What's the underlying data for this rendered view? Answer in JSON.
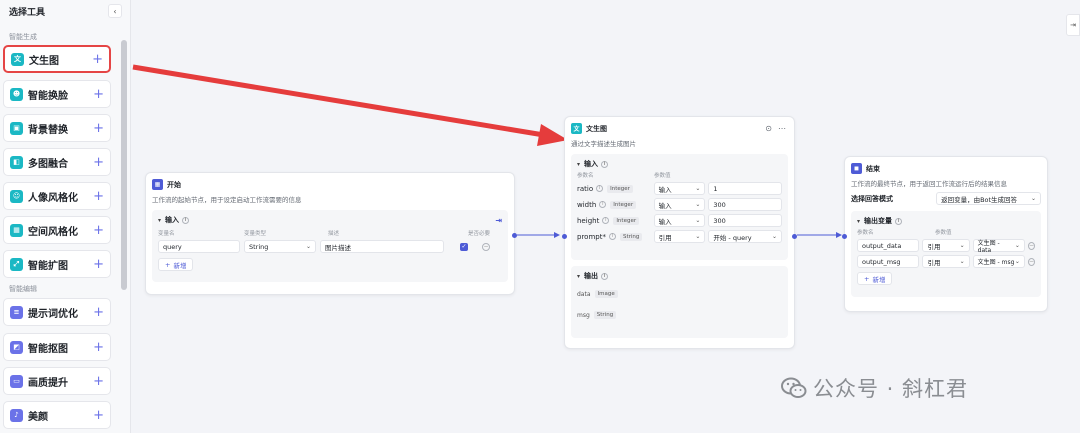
{
  "sidebar": {
    "title": "选择工具",
    "collapse_icon": "‹",
    "section_ai_gen": "智能生成",
    "section_ai_edit": "智能编辑",
    "items": [
      {
        "label": "文生图",
        "icon": "文",
        "color": "teal"
      },
      {
        "label": "智能换脸",
        "icon": "☻",
        "color": "teal"
      },
      {
        "label": "背景替换",
        "icon": "▣",
        "color": "teal"
      },
      {
        "label": "多图融合",
        "icon": "◧",
        "color": "teal"
      },
      {
        "label": "人像风格化",
        "icon": "☺",
        "color": "teal"
      },
      {
        "label": "空间风格化",
        "icon": "▦",
        "color": "teal"
      },
      {
        "label": "智能扩图",
        "icon": "⤢",
        "color": "teal"
      },
      {
        "label": "提示词优化",
        "icon": "≡",
        "color": "purple"
      },
      {
        "label": "智能抠图",
        "icon": "◩",
        "color": "purple"
      },
      {
        "label": "画质提升",
        "icon": "▭",
        "color": "purple"
      },
      {
        "label": "美颜",
        "icon": "♪",
        "color": "purple"
      }
    ],
    "plus": "+"
  },
  "canvas": {
    "corner_label": "⇥"
  },
  "start_node": {
    "title": "开始",
    "desc": "工作流的起始节点，用于设定启动工作流需要的信息",
    "input_label": "输入",
    "col_name": "变量名",
    "col_type": "变量类型",
    "col_desc": "描述",
    "col_required": "是否必要",
    "row": {
      "name": "query",
      "type": "String",
      "desc": "图片描述"
    },
    "add_label": "新增"
  },
  "t2i_node": {
    "title": "文生图",
    "desc": "通过文字描述生成图片",
    "input_label": "输入",
    "col_param": "参数名",
    "col_value": "参数值",
    "params": [
      {
        "name": "ratio",
        "type": "Integer",
        "mode": "输入",
        "value": "1"
      },
      {
        "name": "width",
        "type": "Integer",
        "mode": "输入",
        "value": "300"
      },
      {
        "name": "height",
        "type": "Integer",
        "mode": "输入",
        "value": "300"
      },
      {
        "name": "prompt*",
        "type": "String",
        "mode": "引用",
        "value": "开始 - query"
      }
    ],
    "output_label": "输出",
    "outputs": [
      {
        "name": "data",
        "type": "Image"
      },
      {
        "name": "msg",
        "type": "String"
      }
    ]
  },
  "end_node": {
    "title": "结束",
    "desc": "工作流的最终节点，用于返回工作流运行后的结果信息",
    "mode_label": "选择回答模式",
    "mode_value": "返回变量，由Bot生成回答",
    "output_var_label": "输出变量",
    "col_param": "参数名",
    "col_value": "参数值",
    "rows": [
      {
        "name": "output_data",
        "mode": "引用",
        "value": "文生图 - data"
      },
      {
        "name": "output_msg",
        "mode": "引用",
        "value": "文生图 - msg"
      }
    ],
    "add_label": "新增"
  },
  "watermark": "公众号 · 斜杠君",
  "colors": {
    "accent": "#4e5bd6",
    "highlight": "#e54545",
    "arrow": "#e53c3c",
    "teal": "#1bb8c4",
    "purple": "#6b72e8"
  }
}
